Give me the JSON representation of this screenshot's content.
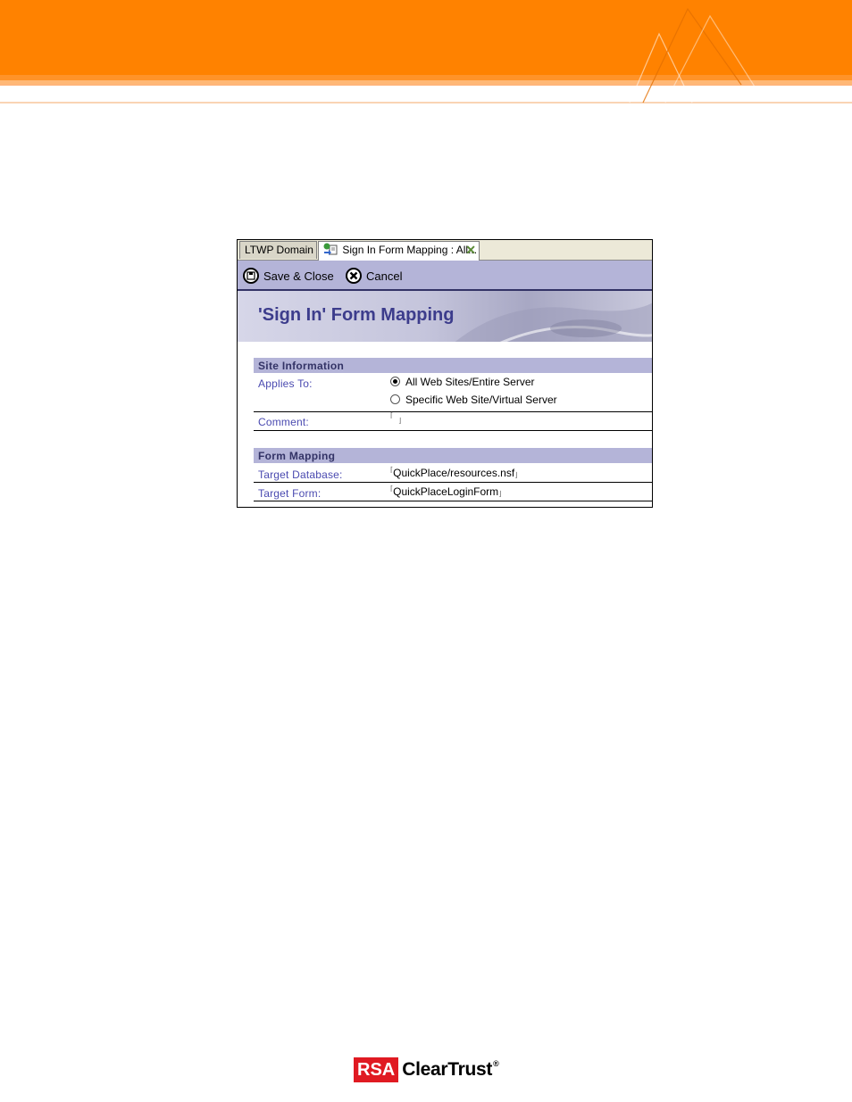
{
  "colors": {
    "banner_orange": "#ff8200",
    "toolbar_lavender": "#b4b4d8",
    "title_blue": "#3c3c8c",
    "label_blue": "#4a4ab0",
    "rsa_red": "#e01a22"
  },
  "tabs": [
    {
      "label": "LTWP Domain",
      "active": false
    },
    {
      "label": "Sign In Form Mapping : All...",
      "active": true,
      "icon": "form-mapping-icon",
      "close_icon": "close-icon"
    }
  ],
  "toolbar": {
    "save_label": "Save & Close",
    "save_icon": "disk-icon",
    "cancel_label": "Cancel",
    "cancel_icon": "cancel-icon"
  },
  "page": {
    "title": "'Sign In' Form Mapping"
  },
  "site_information": {
    "heading": "Site Information",
    "applies_to_label": "Applies To:",
    "options": [
      {
        "label": "All Web Sites/Entire Server",
        "selected": true
      },
      {
        "label": "Specific Web Site/Virtual Server",
        "selected": false
      }
    ],
    "comment_label": "Comment:",
    "comment_value": ""
  },
  "form_mapping": {
    "heading": "Form Mapping",
    "target_database_label": "Target Database:",
    "target_database_value": "QuickPlace/resources.nsf",
    "target_form_label": "Target Form:",
    "target_form_value": "QuickPlaceLoginForm"
  },
  "footer": {
    "logo_rsa": "RSA",
    "logo_product": "ClearTrust",
    "logo_reg": "®"
  }
}
